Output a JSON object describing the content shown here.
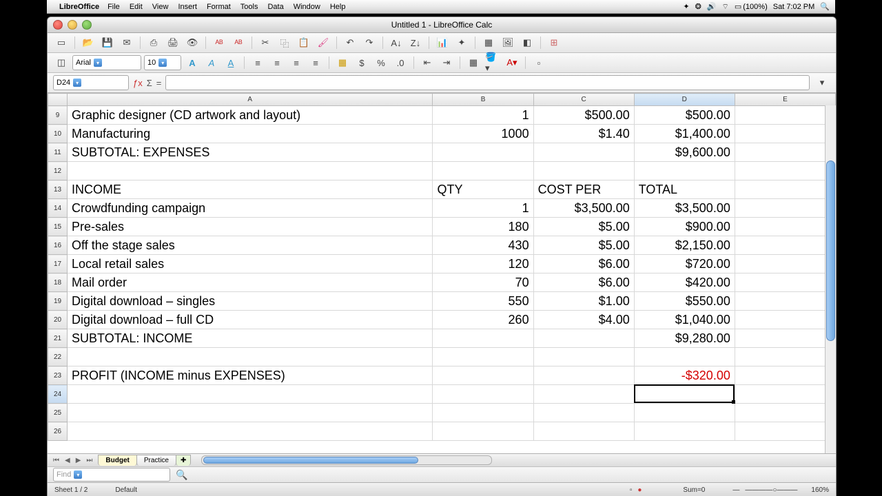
{
  "menubar": {
    "app": "LibreOffice",
    "items": [
      "File",
      "Edit",
      "View",
      "Insert",
      "Format",
      "Tools",
      "Data",
      "Window",
      "Help"
    ],
    "battery": "(100%)",
    "clock": "Sat 7:02 PM"
  },
  "window": {
    "title": "Untitled 1 - LibreOffice Calc"
  },
  "format": {
    "font": "Arial",
    "size": "10"
  },
  "cellref": "D24",
  "columns": [
    "A",
    "B",
    "C",
    "D",
    "E"
  ],
  "rows": [
    {
      "n": 9,
      "a": "Graphic designer (CD artwork and layout)",
      "b": "1",
      "c": "$500.00",
      "d": "$500.00"
    },
    {
      "n": 10,
      "a": "Manufacturing",
      "b": "1000",
      "c": "$1.40",
      "d": "$1,400.00"
    },
    {
      "n": 11,
      "a": "SUBTOTAL: EXPENSES",
      "b": "",
      "c": "",
      "d": "$9,600.00"
    },
    {
      "n": 12,
      "a": "",
      "b": "",
      "c": "",
      "d": ""
    },
    {
      "n": 13,
      "a": "INCOME",
      "b": "QTY",
      "c": "COST PER",
      "d": "TOTAL",
      "hdr": true
    },
    {
      "n": 14,
      "a": "Crowdfunding campaign",
      "b": "1",
      "c": "$3,500.00",
      "d": "$3,500.00"
    },
    {
      "n": 15,
      "a": "Pre-sales",
      "b": "180",
      "c": "$5.00",
      "d": "$900.00"
    },
    {
      "n": 16,
      "a": "Off the stage sales",
      "b": "430",
      "c": "$5.00",
      "d": "$2,150.00"
    },
    {
      "n": 17,
      "a": "Local retail sales",
      "b": "120",
      "c": "$6.00",
      "d": "$720.00"
    },
    {
      "n": 18,
      "a": "Mail order",
      "b": "70",
      "c": "$6.00",
      "d": "$420.00"
    },
    {
      "n": 19,
      "a": "Digital download – singles",
      "b": "550",
      "c": "$1.00",
      "d": "$550.00"
    },
    {
      "n": 20,
      "a": "Digital download – full CD",
      "b": "260",
      "c": "$4.00",
      "d": "$1,040.00"
    },
    {
      "n": 21,
      "a": "SUBTOTAL: INCOME",
      "b": "",
      "c": "",
      "d": "$9,280.00"
    },
    {
      "n": 22,
      "a": "",
      "b": "",
      "c": "",
      "d": ""
    },
    {
      "n": 23,
      "a": "PROFIT (INCOME minus EXPENSES)",
      "b": "",
      "c": "",
      "d": "-$320.00",
      "neg": true
    },
    {
      "n": 24,
      "a": "",
      "b": "",
      "c": "",
      "d": "",
      "sel": true
    },
    {
      "n": 25,
      "a": "",
      "b": "",
      "c": "",
      "d": ""
    },
    {
      "n": 26,
      "a": "",
      "b": "",
      "c": "",
      "d": ""
    }
  ],
  "sheets": {
    "active": "Budget",
    "other": "Practice"
  },
  "findbar": {
    "placeholder": "Find"
  },
  "status": {
    "sheet": "Sheet 1 / 2",
    "style": "Default",
    "sum": "Sum=0",
    "zoom": "160%"
  }
}
